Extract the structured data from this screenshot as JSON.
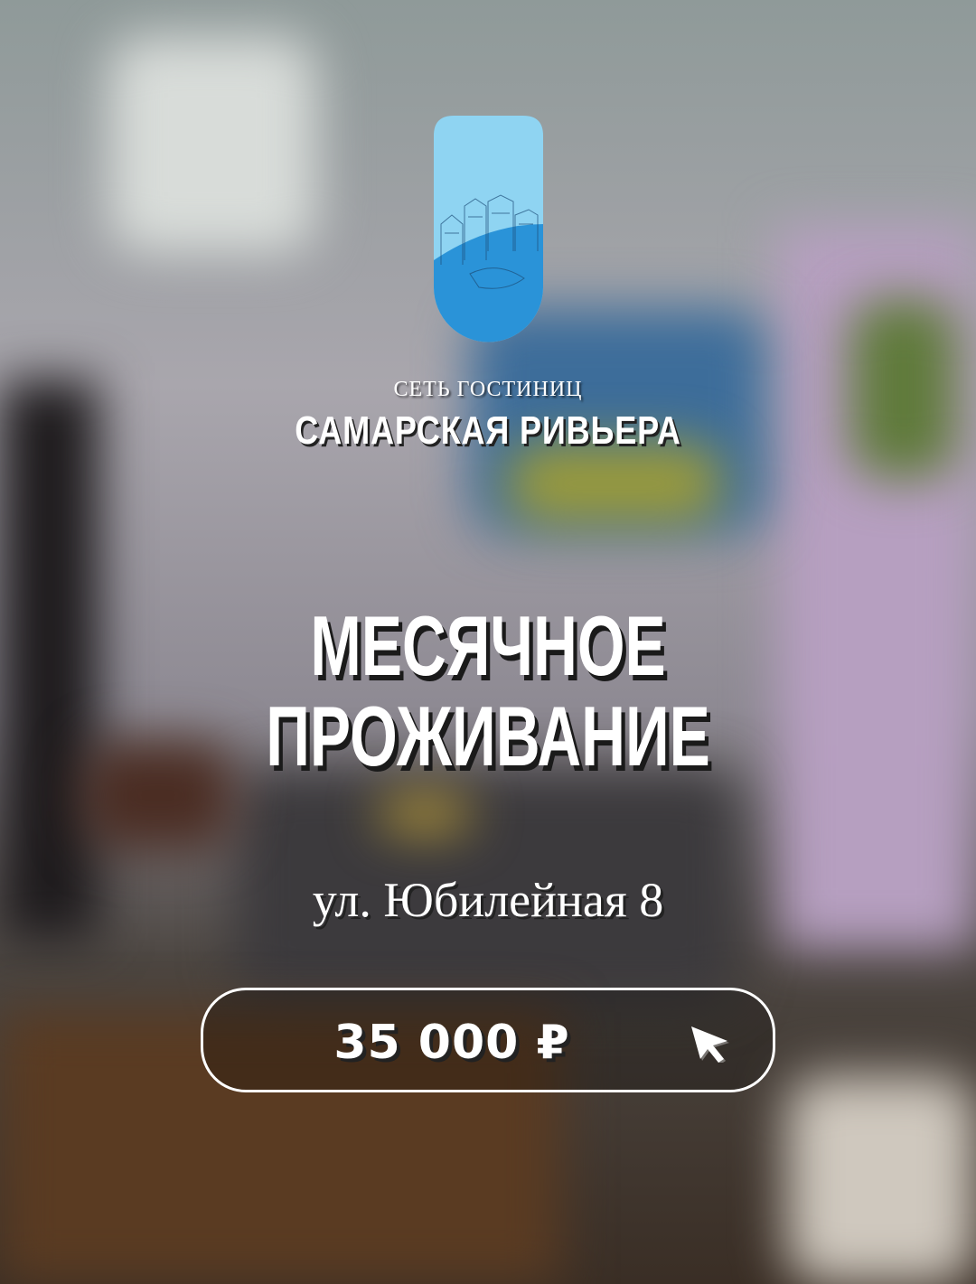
{
  "brand": {
    "small": "СЕТЬ ГОСТИНИЦ",
    "name": "САМАРСКАЯ РИВЬЕРА",
    "colors": {
      "light": "#8fd4f2",
      "dark": "#2a93d8"
    }
  },
  "headline": {
    "line1": "МЕСЯЧНОЕ",
    "line2": "ПРОЖИВАНИЕ"
  },
  "address": "ул. Юбилейная 8",
  "price": {
    "label": "35 000 ₽"
  },
  "icons": {
    "logo": "door-hanger-logo-icon",
    "cursor": "cursor-arrow-icon"
  }
}
